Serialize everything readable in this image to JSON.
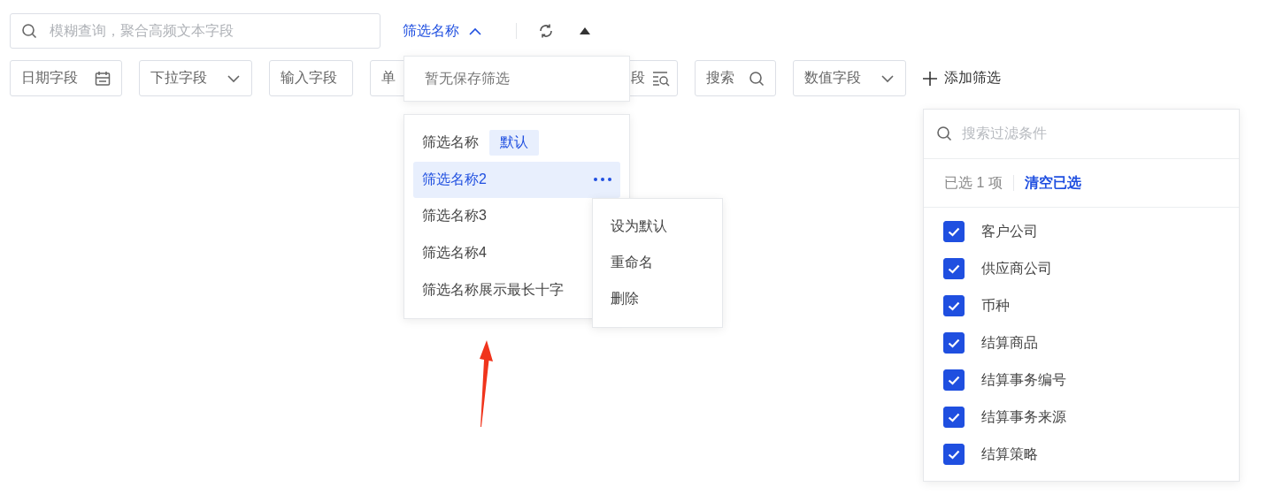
{
  "search": {
    "placeholder": "模糊查询，聚合高频文本字段"
  },
  "filter_menu_button": {
    "label": "筛选名称",
    "expanded": true
  },
  "fields": [
    {
      "label": "日期字段",
      "kind": "date"
    },
    {
      "label": "下拉字段",
      "kind": "select"
    },
    {
      "label": "输入字段",
      "kind": "input"
    },
    {
      "label": "单",
      "kind": "radio"
    },
    {
      "label": "段",
      "kind": "list"
    },
    {
      "label": "搜索",
      "kind": "search"
    },
    {
      "label": "数值字段",
      "kind": "select"
    }
  ],
  "add_filter": {
    "label": "添加筛选"
  },
  "saved_empty": {
    "text": "暂无保存筛选"
  },
  "saved_filters": [
    {
      "name": "筛选名称",
      "tag": "默认",
      "selected": false
    },
    {
      "name": "筛选名称2",
      "selected": true
    },
    {
      "name": "筛选名称3",
      "selected": false
    },
    {
      "name": "筛选名称4",
      "selected": false
    },
    {
      "name": "筛选名称展示最长十字",
      "selected": false
    }
  ],
  "context_menu": [
    "设为默认",
    "重命名",
    "删除"
  ],
  "condition_panel": {
    "placeholder": "搜索过滤条件",
    "selected_count": "已选 1 项",
    "clear": "清空已选",
    "options": [
      {
        "label": "客户公司",
        "checked": true
      },
      {
        "label": "供应商公司",
        "checked": true
      },
      {
        "label": "币种",
        "checked": true
      },
      {
        "label": "结算商品",
        "checked": true
      },
      {
        "label": "结算事务编号",
        "checked": true
      },
      {
        "label": "结算事务来源",
        "checked": true
      },
      {
        "label": "结算策略",
        "checked": true
      }
    ]
  }
}
